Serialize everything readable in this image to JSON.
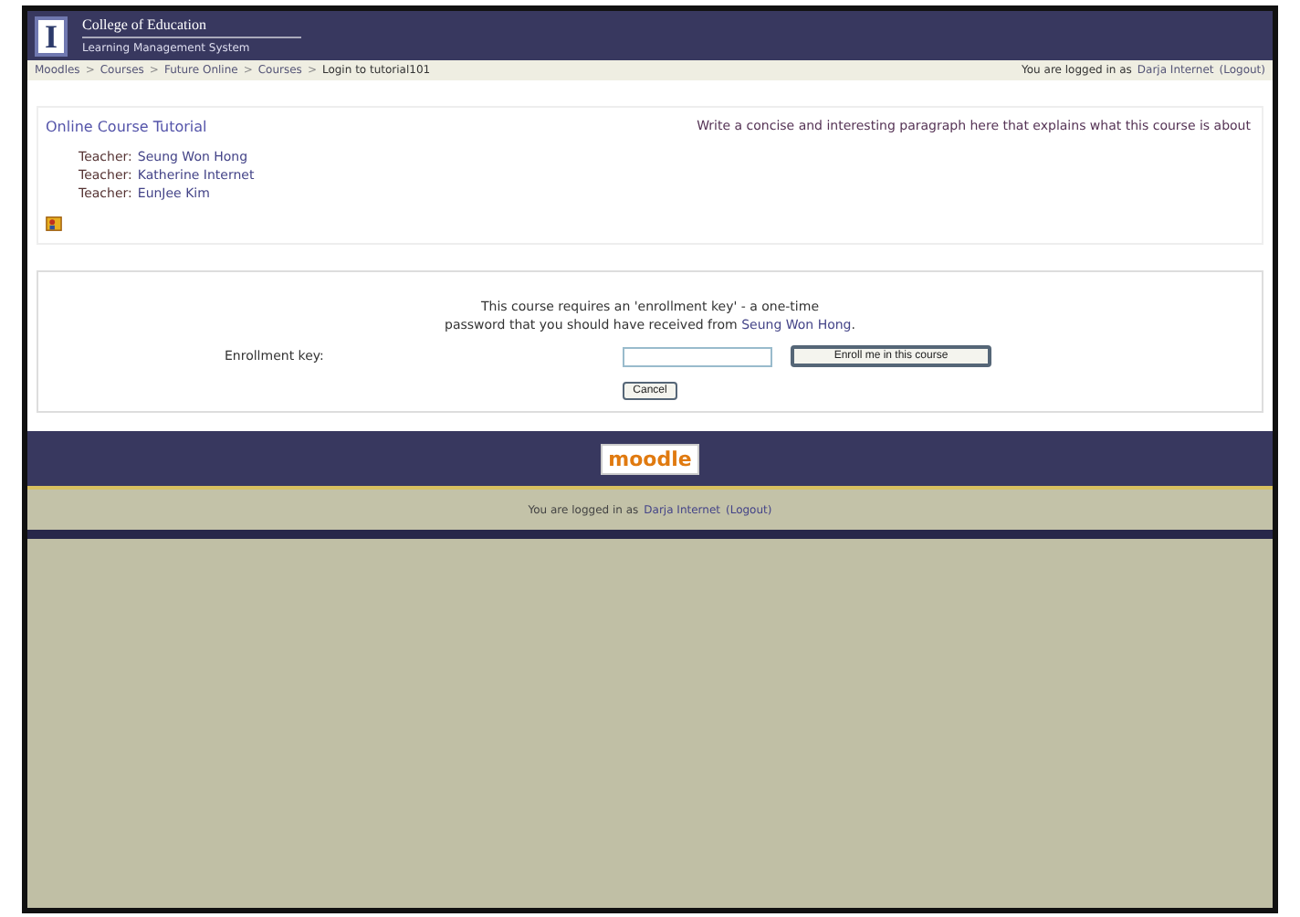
{
  "header": {
    "logo_letter": "I",
    "title": "College of Education",
    "subtitle": "Learning Management System"
  },
  "breadcrumb": {
    "separator": ">",
    "items": [
      "Moodles",
      "Courses",
      "Future Online",
      "Courses",
      "Login to tutorial101"
    ]
  },
  "login_info": {
    "prefix": "You are logged in as",
    "user": "Darja Internet",
    "logout": "(Logout)"
  },
  "course": {
    "title": "Online Course Tutorial",
    "summary": "Write a concise and interesting paragraph here that explains what this course is about",
    "teachers": [
      {
        "label": "Teacher:",
        "name": "Seung Won Hong"
      },
      {
        "label": "Teacher:",
        "name": "Katherine Internet"
      },
      {
        "label": "Teacher:",
        "name": "EunJee Kim"
      }
    ]
  },
  "enrol": {
    "message_1": "This course requires an 'enrollment key' - a one-time",
    "message_2": "password that you should have received from",
    "teacher": "Seung Won Hong",
    "message_end": ".",
    "key_label": "Enrollment key:",
    "enrol_button": "Enroll me in this course",
    "cancel_button": "Cancel"
  },
  "footer": {
    "logo": "moodle",
    "login_info": {
      "prefix": "You are logged in as",
      "user": "Darja Internet",
      "logout": "(Logout)"
    }
  }
}
